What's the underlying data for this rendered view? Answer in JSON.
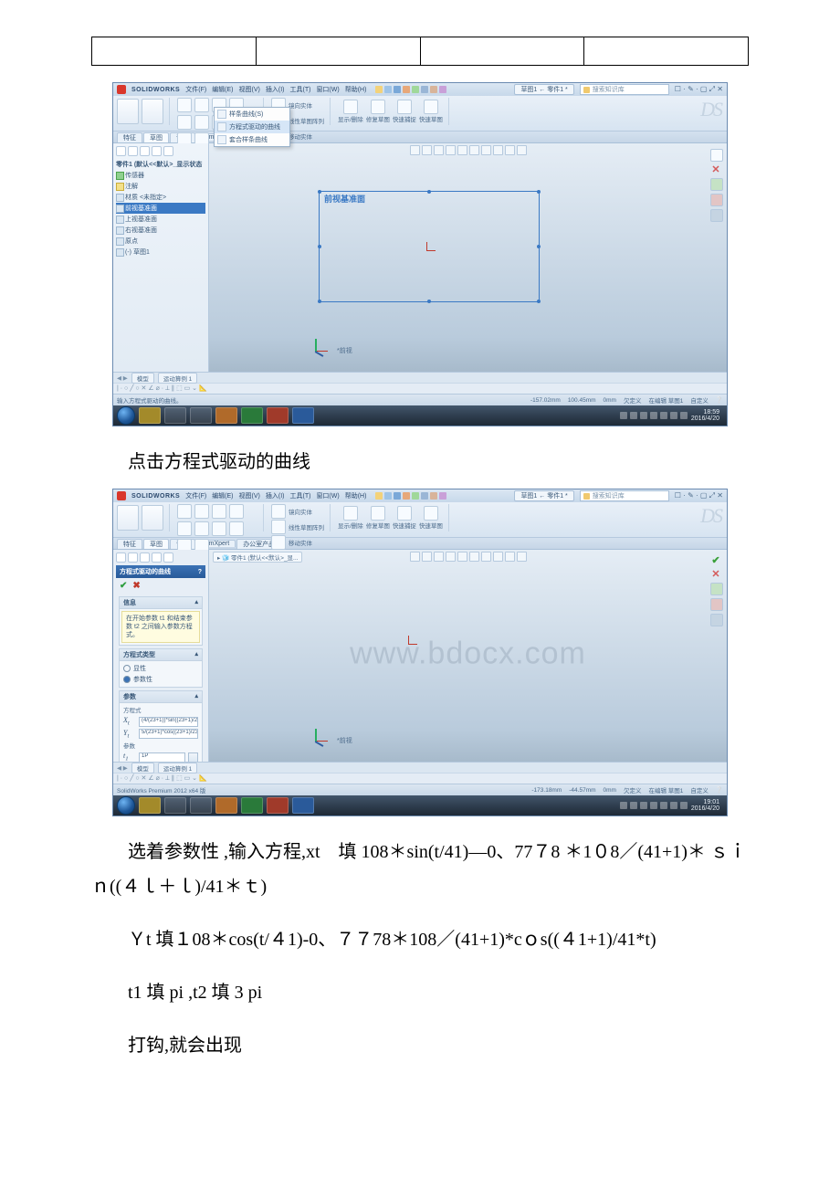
{
  "table": {
    "cells": [
      "",
      "",
      "",
      ""
    ]
  },
  "sw": {
    "brand": "SOLIDWORKS",
    "menus": [
      "文件(F)",
      "编辑(E)",
      "视图(V)",
      "插入(I)",
      "工具(T)",
      "窗口(W)",
      "帮助(H)"
    ],
    "doc_tab": "草图1 ← 零件1 *",
    "search_placeholder": "搜索知识库",
    "winbtns": "☐ · ✎ · ▢ ⤢ ✕",
    "ribbon_labels": [
      "镜向实体",
      "线性草图阵列",
      "移动实体",
      "显示/删除",
      "修复草图",
      "快速捕捉",
      "快速草图"
    ],
    "ds": "DS",
    "tabs1": [
      "特征",
      "草图",
      "评估",
      "DimXpert"
    ],
    "tabs2": [
      "特征",
      "草图",
      "评估",
      "DimXpert",
      "办公室产品"
    ],
    "dropdown": [
      "样条曲线(S)",
      "方程式驱动的曲线",
      "套合样条曲线"
    ],
    "tree1": {
      "root": "零件1 (默认<<默认>_显示状态",
      "items": [
        "传感器",
        "注解",
        "材质 <未指定>",
        "前视基准面",
        "上视基准面",
        "右视基准面",
        "原点",
        "(-) 草图1"
      ]
    },
    "plane_label": "前视基准面",
    "view_label": "*前视",
    "bottom_tabs": [
      "模型",
      "运动算例 1"
    ],
    "status1_msg": "输入方程式驱动的曲线。",
    "status1_coords": [
      "-157.02mm",
      "100.45mm",
      "0mm",
      "欠定义",
      "在编辑 草图1"
    ],
    "status_custom": "自定义",
    "clock1": {
      "time": "18:59",
      "date": "2016/4/20"
    },
    "crumb": "零件1 (默认<<默认>_显...",
    "pm": {
      "title": "方程式驱动的曲线",
      "help": "?",
      "info_title": "信息",
      "info_body": "在开始参数 t1 和结束参数 t2 之间输入参数方程式。",
      "type_title": "方程式类型",
      "type_opts": [
        "显性",
        "参数性"
      ],
      "param_title": "参数",
      "param_sub": "方程式",
      "xt_label": "X",
      "xt_sub": "t",
      "xt_val": "(4/(23+1))*sin((23+1)/23*t)",
      "yt_label": "Y",
      "yt_sub": "t",
      "yt_val": "5/(23+1)*cos((23+1)/23*t)",
      "params_label": "参数",
      "t1_label": "t",
      "t1_sub": "1",
      "t1_val": "1P",
      "t2_label": "t",
      "t2_sub": "2",
      "t2_val": "3P"
    },
    "status2_msg": "SolidWorks Premium 2012 x64 版",
    "status2_coords": [
      "-173.18mm",
      "-44.57mm",
      "0mm",
      "欠定义",
      "在编辑 草图1"
    ],
    "clock2": {
      "time": "19:01",
      "date": "2016/4/20"
    }
  },
  "text": {
    "p1": "点击方程式驱动的曲线",
    "p2": "选着参数性 ,输入方程,xt　填 108＊sin(t/41)—0、77７8 ＊1０8／(41+1)＊ ｓｉｎ((４ｌ＋ｌ)/41＊ｔ)",
    "p3": "Ｙt 填１08＊cos(t/４1)-0、７７78＊108／(41+1)*cｏs((４1+1)/41*t)",
    "p4": "t1 填 pi ,t2 填 3 pi",
    "p5": "打钩,就会出现"
  },
  "watermark": "www.bdocx.com"
}
